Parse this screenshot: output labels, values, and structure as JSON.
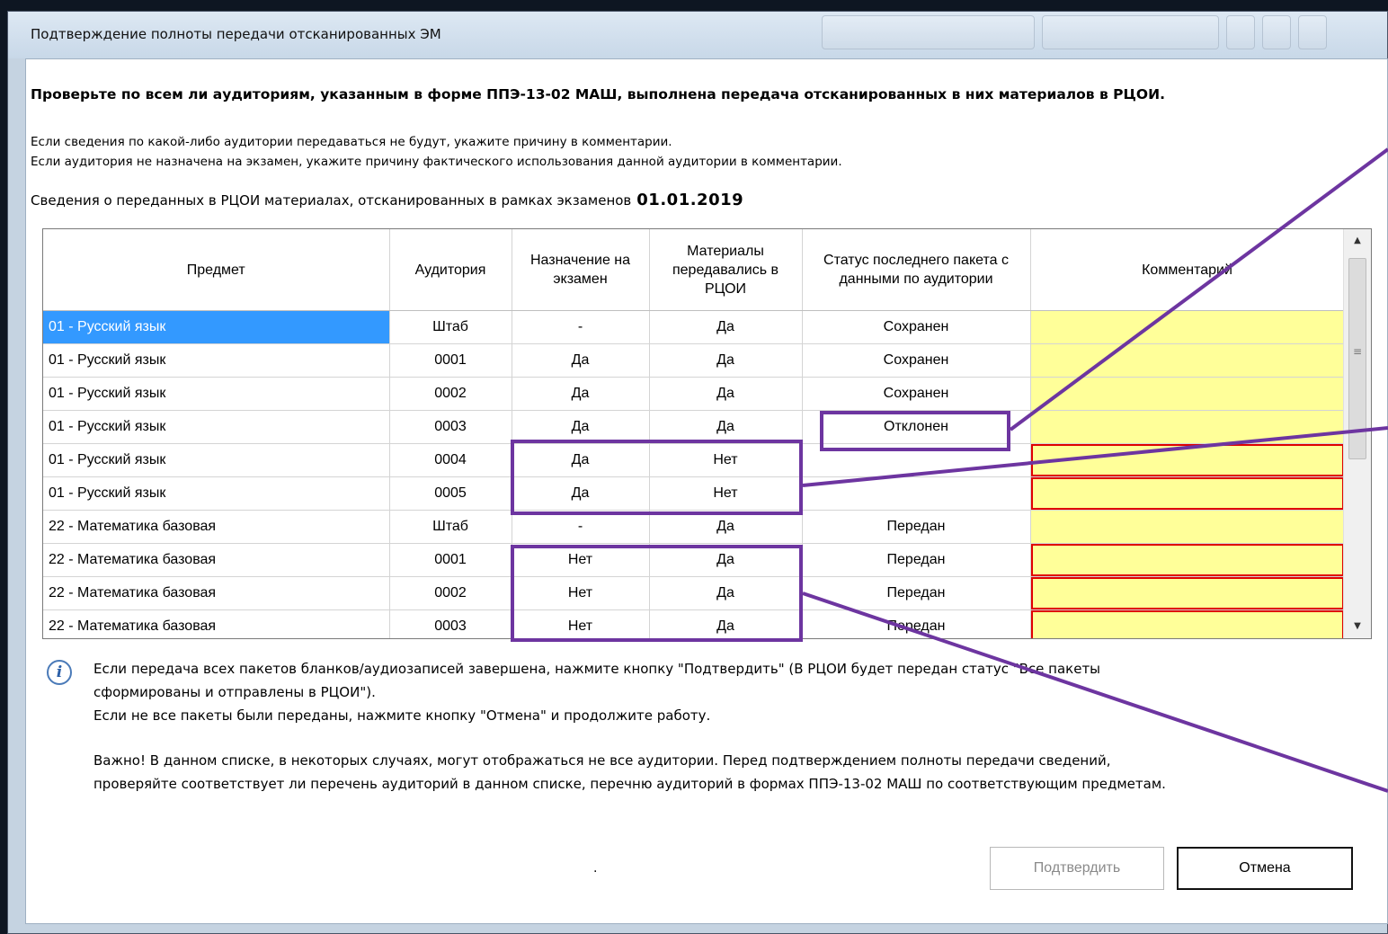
{
  "window": {
    "title": "Подтверждение полноты передачи отсканированных ЭМ"
  },
  "heading": "Проверьте по всем ли аудиториям, указанным в форме ППЭ-13-02 МАШ, выполнена передача отсканированных в них материалов в РЦОИ.",
  "notes": [
    "Если сведения по какой-либо аудитории передаваться не будут, укажите причину в комментарии.",
    "Если аудитория не назначена на экзамен, укажите причину фактического использования данной аудитории в комментарии."
  ],
  "info": {
    "label": "Сведения о переданных в РЦОИ материалах, отсканированных в рамках экзаменов",
    "date": "01.01.2019"
  },
  "table": {
    "headers": [
      "Предмет",
      "Аудитория",
      "Назначение на экзамен",
      "Материалы передавались в РЦОИ",
      "Статус последнего пакета с данными по аудитории",
      "Комментарий"
    ],
    "rows": [
      {
        "subject": "01 - Русский язык",
        "room": "Штаб",
        "assigned": "-",
        "sent": "Да",
        "status": "Сохранен",
        "comment": "",
        "selected": true
      },
      {
        "subject": "01 - Русский язык",
        "room": "0001",
        "assigned": "Да",
        "sent": "Да",
        "status": "Сохранен",
        "comment": ""
      },
      {
        "subject": "01 - Русский язык",
        "room": "0002",
        "assigned": "Да",
        "sent": "Да",
        "status": "Сохранен",
        "comment": ""
      },
      {
        "subject": "01 - Русский язык",
        "room": "0003",
        "assigned": "Да",
        "sent": "Да",
        "status": "Отклонен",
        "comment": ""
      },
      {
        "subject": "01 - Русский язык",
        "room": "0004",
        "assigned": "Да",
        "sent": "Нет",
        "status": "",
        "comment": "",
        "error": true
      },
      {
        "subject": "01 - Русский язык",
        "room": "0005",
        "assigned": "Да",
        "sent": "Нет",
        "status": "",
        "comment": "",
        "error": true
      },
      {
        "subject": "22 - Математика базовая",
        "room": "Штаб",
        "assigned": "-",
        "sent": "Да",
        "status": "Передан",
        "comment": ""
      },
      {
        "subject": "22 - Математика базовая",
        "room": "0001",
        "assigned": "Нет",
        "sent": "Да",
        "status": "Передан",
        "comment": "",
        "error": true
      },
      {
        "subject": "22 - Математика базовая",
        "room": "0002",
        "assigned": "Нет",
        "sent": "Да",
        "status": "Передан",
        "comment": "",
        "error": true
      },
      {
        "subject": "22 - Математика базовая",
        "room": "0003",
        "assigned": "Нет",
        "sent": "Да",
        "status": "Передан",
        "comment": "",
        "error": true
      }
    ]
  },
  "messages": [
    "Если передача всех пакетов бланков/аудиозаписей завершена, нажмите кнопку \"Подтвердить\" (В РЦОИ будет передан статус \"Все пакеты",
    "сформированы и отправлены в РЦОИ\").",
    "Если не все пакеты были переданы, нажмите кнопку \"Отмена\" и продолжите работу.",
    "Важно! В данном списке, в некоторых случаях, могут отображаться не все аудитории. Перед подтверждением полноты передачи сведений,",
    "проверяйте соответствует ли перечень аудиторий в данном списке, перечню аудиторий в формах ППЭ-13-02 МАШ по соответствующим предметам."
  ],
  "buttons": {
    "confirm": "Подтвердить",
    "cancel": "Отмена"
  },
  "dot": ".",
  "icons": {
    "info": "info-icon",
    "scroll_up": "scroll-up-icon",
    "scroll_down": "scroll-down-icon"
  },
  "colors": {
    "yes": "#1a8a1a",
    "no": "#e00000",
    "comment_bg": "#ffff99",
    "highlight": "#6d35a0",
    "selection": "#3399ff"
  }
}
